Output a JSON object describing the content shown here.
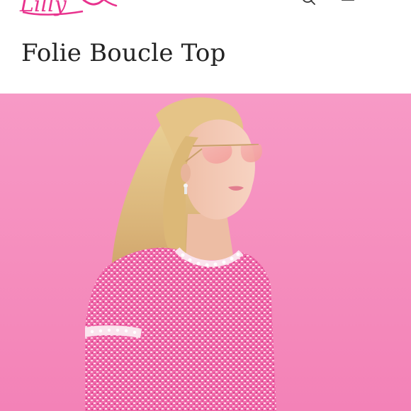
{
  "brand": {
    "logo_text": "Lilly Pulitzer",
    "logo_color": "#e8338e"
  },
  "header": {
    "icons": [
      "search-icon",
      "bag-icon"
    ]
  },
  "product": {
    "title": "Folie Boucle Top"
  },
  "hero": {
    "background_color": "#f58dbd",
    "garment_color": "#f06aaa"
  }
}
